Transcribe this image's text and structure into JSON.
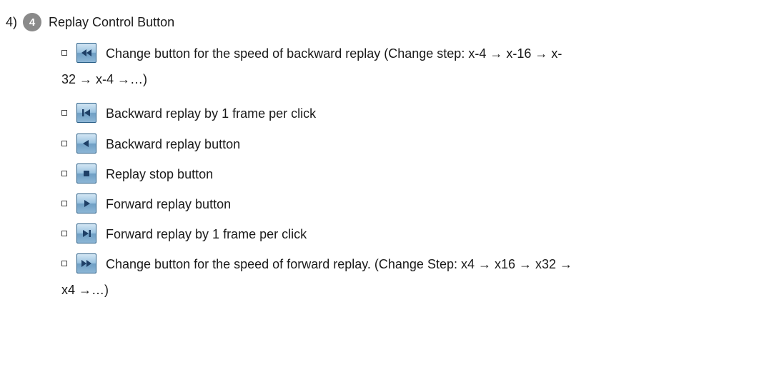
{
  "section": {
    "number": "4)",
    "badge": "4",
    "title": "Replay Control Button"
  },
  "items": [
    {
      "icon": "fast-backward-icon",
      "text": "Change button for the speed of backward replay (Change step: x-4 → x-16 → x-",
      "continuation": "32 → x-4 →…)"
    },
    {
      "icon": "step-backward-icon",
      "text": "Backward replay by 1 frame per click"
    },
    {
      "icon": "play-backward-icon",
      "text": "Backward replay button"
    },
    {
      "icon": "stop-icon",
      "text": "Replay stop button"
    },
    {
      "icon": "play-forward-icon",
      "text": "Forward replay button"
    },
    {
      "icon": "step-forward-icon",
      "text": "Forward replay by 1 frame per click"
    },
    {
      "icon": "fast-forward-icon",
      "text": "Change button for the speed of forward replay. (Change Step: x4 → x16 → x32 →",
      "continuation": "x4 →…)"
    }
  ]
}
